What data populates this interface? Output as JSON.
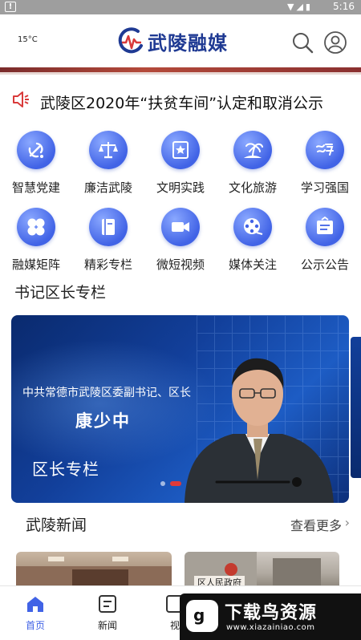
{
  "status_bar": {
    "time": "5:16"
  },
  "header": {
    "weather": "15°C",
    "logo_text": "武陵融媒"
  },
  "notice": {
    "text": "武陵区2020年“扶贫车间”认定和取消公示"
  },
  "grid": [
    {
      "label": "智慧党建",
      "icon": "party-emblem-icon"
    },
    {
      "label": "廉洁武陵",
      "icon": "justice-scale-icon"
    },
    {
      "label": "文明实践",
      "icon": "star-badge-icon"
    },
    {
      "label": "文化旅游",
      "icon": "palm-island-icon"
    },
    {
      "label": "学习强国",
      "icon": "xuexi-script-icon"
    },
    {
      "label": "融媒矩阵",
      "icon": "matrix-petals-icon"
    },
    {
      "label": "精彩专栏",
      "icon": "book-icon"
    },
    {
      "label": "微短视频",
      "icon": "video-camera-icon"
    },
    {
      "label": "媒体关注",
      "icon": "film-reel-icon"
    },
    {
      "label": "公示公告",
      "icon": "notice-board-icon"
    }
  ],
  "column_section": {
    "title": "书记区长专栏"
  },
  "banner": {
    "subtitle": "中共常德市武陵区委副书记、区长",
    "name": "康少中",
    "caption": "区长专栏"
  },
  "news": {
    "title": "武陵新闻",
    "more": "查看更多",
    "card_sign": "区人民政府"
  },
  "bottom_nav": [
    {
      "label": "首页",
      "icon": "home-icon",
      "active": true
    },
    {
      "label": "新闻",
      "icon": "news-icon",
      "active": false
    },
    {
      "label": "视",
      "icon": "video-icon",
      "active": false
    }
  ],
  "watermark": {
    "logo": "g",
    "title": "下载鸟资源",
    "url": "www.xiazainiao.com"
  },
  "colors": {
    "accent": "#4163e6",
    "logo_blue": "#1f3a93",
    "notice_red": "#d93a3a"
  }
}
